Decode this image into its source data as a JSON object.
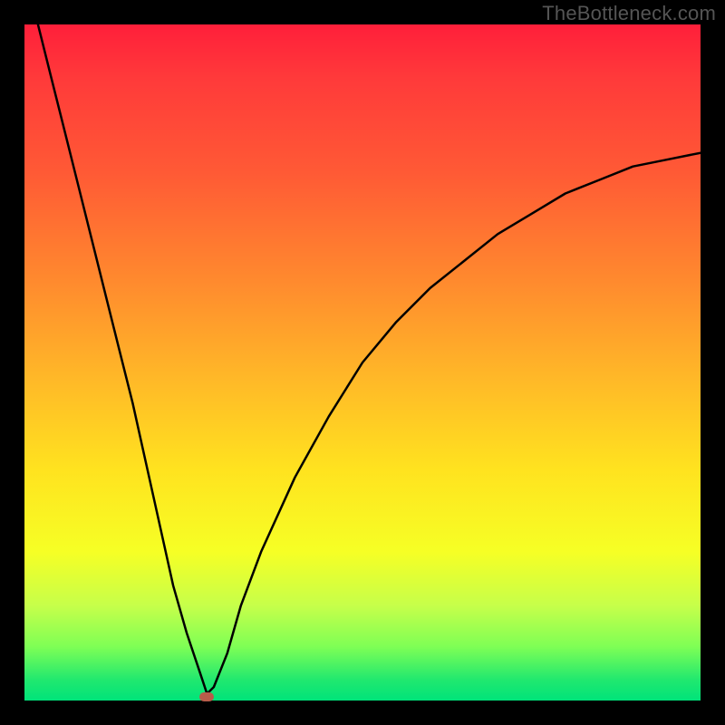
{
  "watermark": "TheBottleneck.com",
  "colors": {
    "frame": "#000000",
    "gradient_top": "#ff1f3a",
    "gradient_bottom": "#00e37a",
    "curve": "#000000",
    "marker": "#b85c4a"
  },
  "chart_data": {
    "type": "line",
    "title": "",
    "xlabel": "",
    "ylabel": "",
    "xlim": [
      0,
      100
    ],
    "ylim": [
      0,
      100
    ],
    "grid": false,
    "legend": false,
    "series": [
      {
        "name": "bottleneck-curve",
        "x": [
          2,
          4,
          6,
          8,
          10,
          12,
          14,
          16,
          18,
          20,
          22,
          24,
          26,
          27,
          28,
          30,
          32,
          35,
          40,
          45,
          50,
          55,
          60,
          65,
          70,
          75,
          80,
          85,
          90,
          95,
          100
        ],
        "values": [
          100,
          92,
          84,
          76,
          68,
          60,
          52,
          44,
          35,
          26,
          17,
          10,
          4,
          1,
          2,
          7,
          14,
          22,
          33,
          42,
          50,
          56,
          61,
          65,
          69,
          72,
          75,
          77,
          79,
          80,
          81
        ]
      }
    ],
    "minimum_point": {
      "x": 27,
      "y": 0.5
    }
  }
}
